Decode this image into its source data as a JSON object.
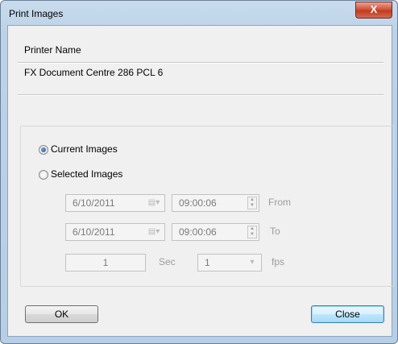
{
  "window": {
    "title": "Print Images",
    "close_glyph": "X"
  },
  "printer": {
    "label": "Printer Name",
    "value": "FX Document Centre 286 PCL 6"
  },
  "options": {
    "current_images_label": "Current Images",
    "selected_images_label": "Selected Images",
    "selected_option": "Current Images"
  },
  "range": {
    "from_date": "6/10/2011",
    "from_time": "09:00:06",
    "from_label": "From",
    "to_date": "6/10/2011",
    "to_time": "09:00:06",
    "to_label": "To",
    "interval_value": "1",
    "interval_unit": "Sec",
    "fps_value": "1",
    "fps_unit": "fps"
  },
  "buttons": {
    "ok": "OK",
    "close": "Close"
  }
}
